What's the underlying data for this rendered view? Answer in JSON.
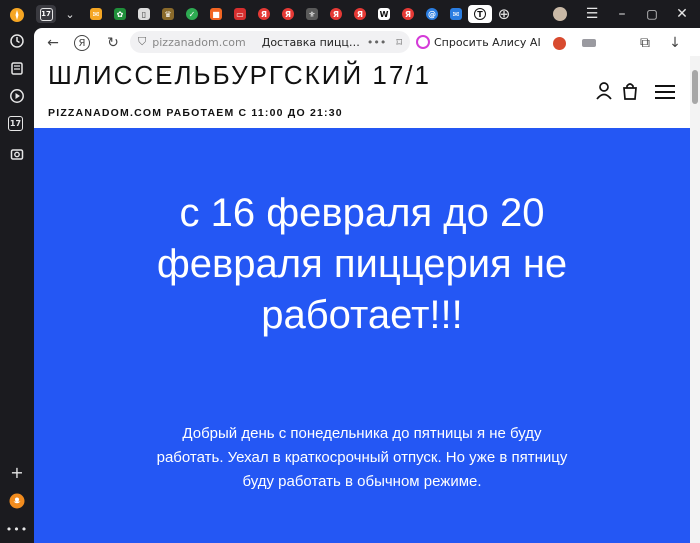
{
  "browser": {
    "active_tab_badge": "17",
    "tabs": [
      {
        "name": "yandex-tab",
        "color": "#f6a623",
        "glyph": "✦"
      },
      {
        "name": "calendar-tab",
        "color": "#3a3a40",
        "glyph": "17"
      },
      {
        "name": "tab-dropdown",
        "color": "#3a3a40",
        "glyph": "⌄"
      },
      {
        "name": "mail-tab",
        "color": "#f5a623",
        "glyph": "✉"
      },
      {
        "name": "gear-tab",
        "color": "#1f8f3a",
        "glyph": "✿"
      },
      {
        "name": "doc-tab",
        "color": "#dddddd",
        "glyph": "▯"
      },
      {
        "name": "emblem-tab",
        "color": "#8a6a2b",
        "glyph": "♛"
      },
      {
        "name": "check-tab",
        "color": "#2eaa52",
        "glyph": "✓"
      },
      {
        "name": "orange-tab",
        "color": "#f26522",
        "glyph": "■"
      },
      {
        "name": "red-tab",
        "color": "#d62e2e",
        "glyph": "▭"
      },
      {
        "name": "yandex-tab-2",
        "color": "#e53935",
        "glyph": "Я"
      },
      {
        "name": "yandex-tab-3",
        "color": "#e53935",
        "glyph": "Я"
      },
      {
        "name": "gov-tab",
        "color": "#5a5a5a",
        "glyph": "⚜"
      },
      {
        "name": "yandex-tab-4",
        "color": "#e53935",
        "glyph": "Я"
      },
      {
        "name": "yandex-tab-5",
        "color": "#e53935",
        "glyph": "Я"
      },
      {
        "name": "wiki-tab",
        "color": "#ffffff",
        "glyph": "W"
      },
      {
        "name": "yandex-tab-6",
        "color": "#e53935",
        "glyph": "Я"
      },
      {
        "name": "at-tab",
        "color": "#2a7de1",
        "glyph": "@"
      },
      {
        "name": "mail-tab-2",
        "color": "#2a7de1",
        "glyph": "✉"
      },
      {
        "name": "current-tab",
        "color": "#ffffff",
        "glyph": "Т"
      }
    ],
    "address_domain": "pizzanadom.com",
    "address_title": "Доставка пицц…",
    "alice_label": "Спросить Алису AI",
    "calendar_badge": "17"
  },
  "site": {
    "name": "ШЛИССЕЛЬБУРГСКИЙ 17/1",
    "subtitle": "PIZZANADOM.COM РАБОТАЕМ С 11:00 ДО 21:30",
    "hero_title": "с 16 февраля до 20 февраля пиццерия не работает!!!",
    "hero_text": "Добрый день с понедельника до пятницы я не буду работать. Уехал в краткосрочный отпуск. Но уже в пятницу буду работать в обычном режиме.",
    "accent_color": "#2457f4"
  }
}
